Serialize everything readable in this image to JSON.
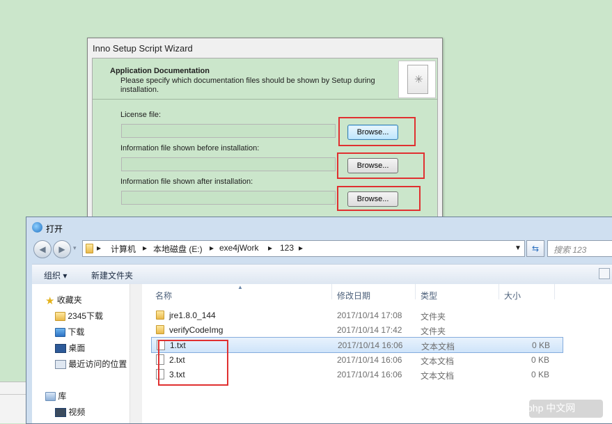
{
  "wizard": {
    "title": "Inno Setup Script Wizard",
    "heading": "Application Documentation",
    "subtitle": "Please specify which documentation files should be shown by Setup during installation.",
    "fields": [
      {
        "label": "License file:",
        "value": "",
        "button": "Browse..."
      },
      {
        "label": "Information file shown before installation:",
        "value": "",
        "button": "Browse..."
      },
      {
        "label": "Information file shown after installation:",
        "value": "",
        "button": "Browse..."
      }
    ]
  },
  "dialog": {
    "title": "打开",
    "breadcrumb": [
      "计算机",
      "本地磁盘 (E:)",
      "exe4jWork",
      "123"
    ],
    "search_placeholder": "搜索 123",
    "toolbar": {
      "organize": "组织 ▾",
      "new_folder": "新建文件夹"
    },
    "nav": {
      "favorites_label": "收藏夹",
      "favorites": [
        "2345下载",
        "下载",
        "桌面",
        "最近访问的位置"
      ],
      "library_label": "库",
      "library": [
        "视频"
      ]
    },
    "columns": [
      "名称",
      "修改日期",
      "类型",
      "大小"
    ],
    "files": [
      {
        "name": "jre1.8.0_144",
        "date": "2017/10/14 17:08",
        "type": "文件夹",
        "size": "",
        "kind": "folder"
      },
      {
        "name": "verifyCodeImg",
        "date": "2017/10/14 17:42",
        "type": "文件夹",
        "size": "",
        "kind": "folder"
      },
      {
        "name": "1.txt",
        "date": "2017/10/14 16:06",
        "type": "文本文档",
        "size": "0 KB",
        "kind": "file"
      },
      {
        "name": "2.txt",
        "date": "2017/10/14 16:06",
        "type": "文本文档",
        "size": "0 KB",
        "kind": "file"
      },
      {
        "name": "3.txt",
        "date": "2017/10/14 16:06",
        "type": "文本文档",
        "size": "0 KB",
        "kind": "file"
      }
    ]
  },
  "watermark": "php 中文网",
  "colors": {
    "highlight_red": "#e03030",
    "wizard_bg": "#cbe6cb",
    "selected_row": "#cfe4fa"
  }
}
